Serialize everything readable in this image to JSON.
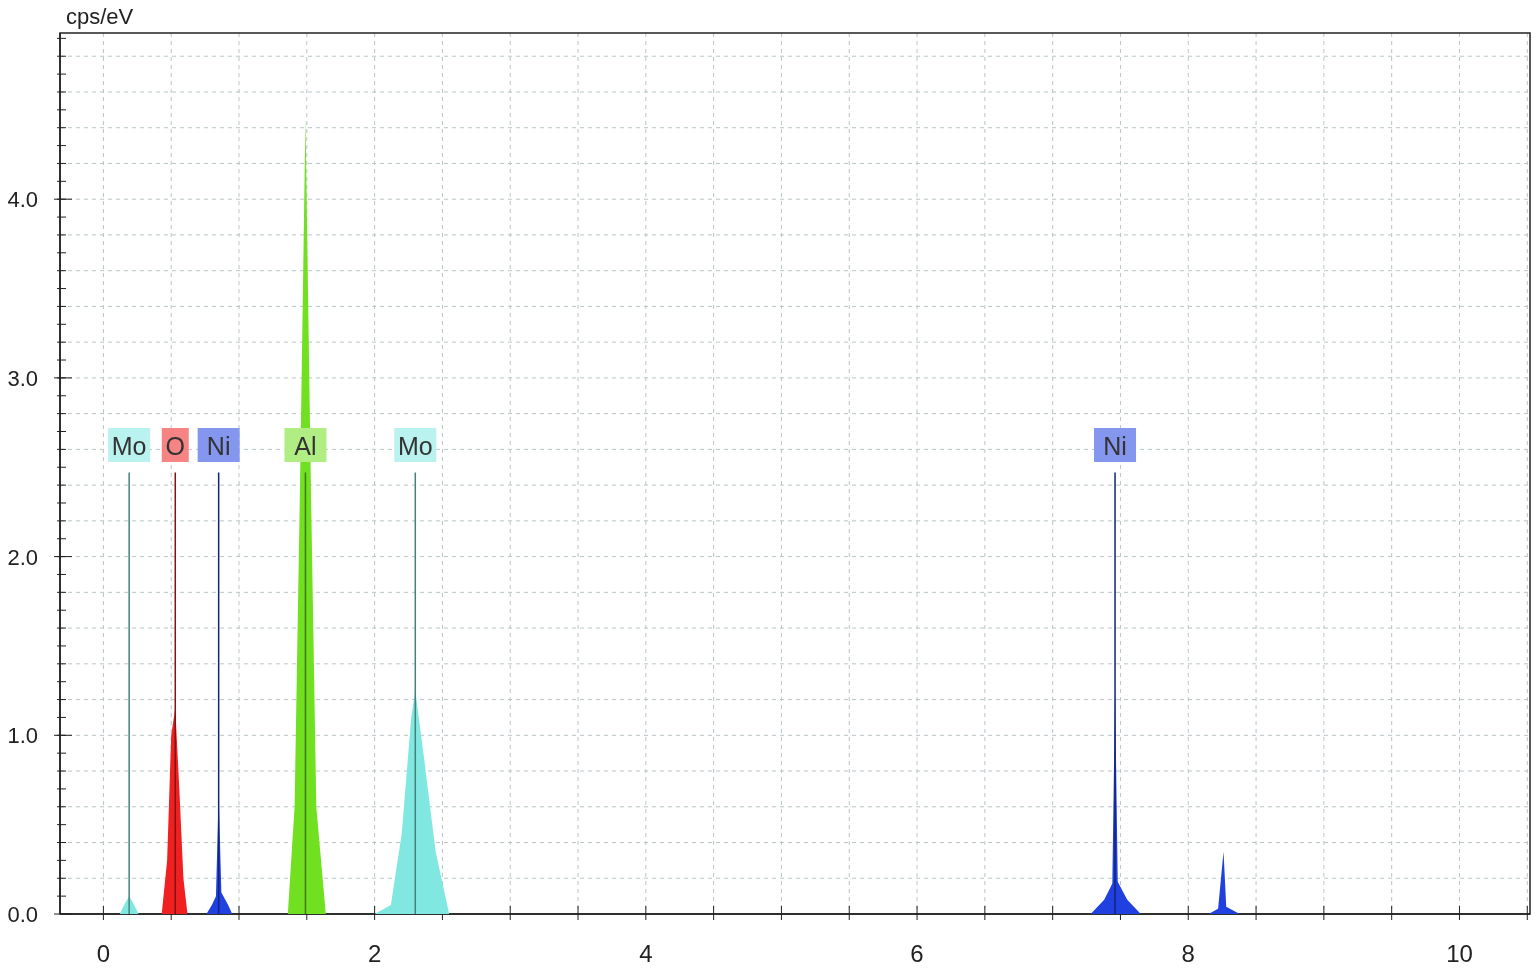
{
  "chart_data": {
    "type": "area",
    "grid": true,
    "ylabel": "cps/eV",
    "xlim": [
      -0.32,
      10.52
    ],
    "ylim": [
      0,
      4.93
    ],
    "xticks": [
      0,
      2,
      4,
      6,
      8,
      10
    ],
    "yticks": [
      {
        "value": 0,
        "label": "0.0"
      },
      {
        "value": 1,
        "label": "1.0"
      },
      {
        "value": 2,
        "label": "2.0"
      },
      {
        "value": 3,
        "label": "3.0"
      },
      {
        "value": 4,
        "label": "4.0"
      }
    ],
    "x": [
      0.12,
      0.16,
      0.19,
      0.22,
      0.26,
      0.43,
      0.47,
      0.5,
      0.53,
      0.56,
      0.59,
      0.62,
      0.76,
      0.8,
      0.83,
      0.85,
      0.87,
      0.92,
      0.95,
      1.36,
      1.41,
      1.45,
      1.49,
      1.53,
      1.57,
      1.64,
      2.0,
      2.12,
      2.2,
      2.27,
      2.3,
      2.36,
      2.45,
      2.55,
      7.28,
      7.38,
      7.44,
      7.46,
      7.48,
      7.55,
      7.65,
      8.15,
      8.22,
      8.26,
      8.28,
      8.38
    ],
    "series": [
      {
        "name": "Mo",
        "color": "#80e8e0",
        "values": [
          0,
          0.06,
          0.1,
          0.06,
          0,
          null,
          null,
          null,
          null,
          null,
          null,
          null,
          null,
          null,
          null,
          null,
          null,
          null,
          null,
          null,
          null,
          null,
          null,
          null,
          null,
          null,
          null,
          null,
          null,
          null,
          null,
          null,
          null,
          null,
          null,
          null,
          null,
          null,
          null,
          null,
          null,
          null,
          null,
          null,
          null,
          null
        ]
      },
      {
        "name": "O",
        "color": "#f02020",
        "values": [
          null,
          null,
          null,
          null,
          null,
          0,
          0.3,
          1.0,
          1.15,
          0.7,
          0.2,
          0,
          null,
          null,
          null,
          null,
          null,
          null,
          null,
          null,
          null,
          null,
          null,
          null,
          null,
          null,
          null,
          null,
          null,
          null,
          null,
          null,
          null,
          null,
          null,
          null,
          null,
          null,
          null,
          null,
          null,
          null,
          null,
          null,
          null,
          null
        ]
      },
      {
        "name": "Ni",
        "color": "#2040e0",
        "values": [
          null,
          null,
          null,
          null,
          null,
          null,
          null,
          null,
          null,
          null,
          null,
          null,
          0,
          0.05,
          0.1,
          0.67,
          0.12,
          0.05,
          0,
          null,
          null,
          null,
          null,
          null,
          null,
          null,
          null,
          null,
          null,
          null,
          null,
          null,
          null,
          null,
          null,
          null,
          null,
          null,
          null,
          null,
          null,
          null,
          null,
          null,
          null,
          null
        ]
      },
      {
        "name": "Al",
        "color": "#70e020",
        "values": [
          null,
          null,
          null,
          null,
          null,
          null,
          null,
          null,
          null,
          null,
          null,
          null,
          null,
          null,
          null,
          null,
          null,
          null,
          null,
          0,
          0.6,
          2.4,
          4.45,
          2.4,
          0.6,
          0,
          null,
          null,
          null,
          null,
          null,
          null,
          null,
          null,
          null,
          null,
          null,
          null,
          null,
          null,
          null,
          null,
          null,
          null,
          null,
          null
        ]
      },
      {
        "name": "Mo",
        "color": "#80e8e0",
        "values": [
          null,
          null,
          null,
          null,
          null,
          null,
          null,
          null,
          null,
          null,
          null,
          null,
          null,
          null,
          null,
          null,
          null,
          null,
          null,
          null,
          null,
          null,
          null,
          null,
          null,
          null,
          0,
          0.05,
          0.45,
          1.1,
          1.25,
          0.9,
          0.35,
          0,
          null,
          null,
          null,
          null,
          null,
          null,
          null,
          null,
          null,
          null,
          null,
          null
        ]
      },
      {
        "name": "Ni",
        "color": "#2040e0",
        "values": [
          null,
          null,
          null,
          null,
          null,
          null,
          null,
          null,
          null,
          null,
          null,
          null,
          null,
          null,
          null,
          null,
          null,
          null,
          null,
          null,
          null,
          null,
          null,
          null,
          null,
          null,
          null,
          null,
          null,
          null,
          null,
          null,
          null,
          null,
          0,
          0.08,
          0.17,
          1.25,
          0.18,
          0.08,
          0,
          0,
          0.03,
          0.35,
          0.04,
          0
        ]
      }
    ]
  }
}
